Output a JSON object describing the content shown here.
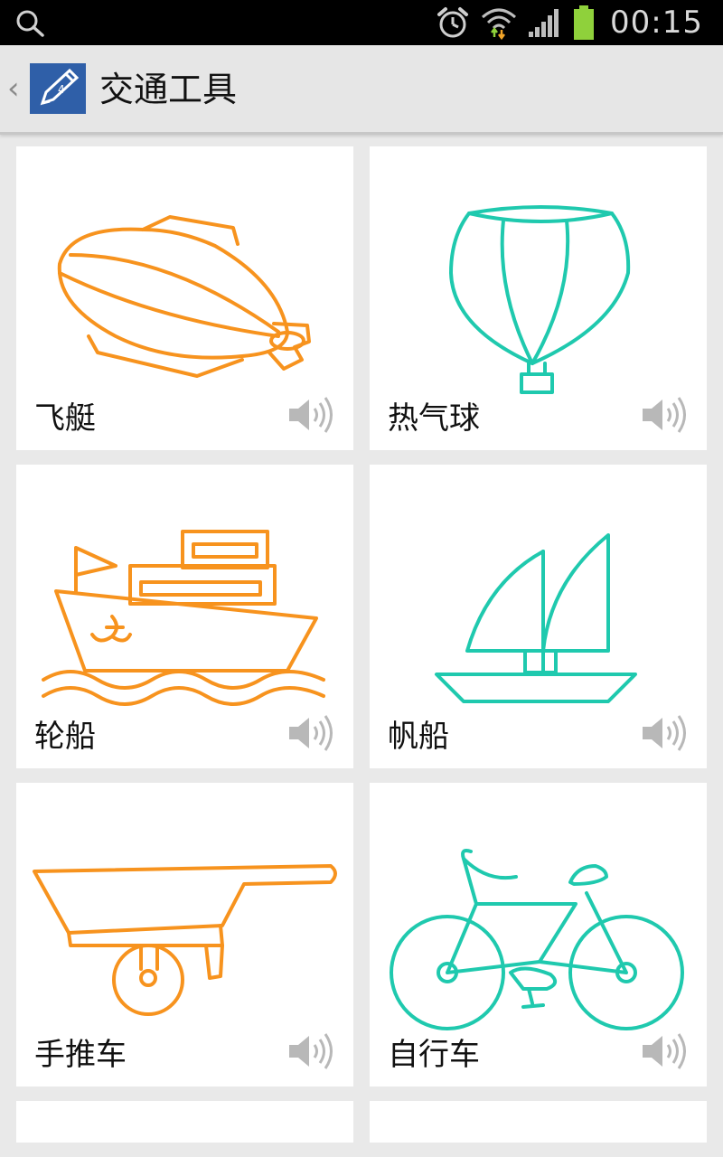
{
  "status_bar": {
    "time": "00:15"
  },
  "action_bar": {
    "title": "交通工具"
  },
  "items": [
    {
      "label": "飞艇"
    },
    {
      "label": "热气球"
    },
    {
      "label": "轮船"
    },
    {
      "label": "帆船"
    },
    {
      "label": "手推车"
    },
    {
      "label": "自行车"
    }
  ],
  "colors": {
    "orange": "#f7931e",
    "teal": "#1fc9ae",
    "app_icon_bg": "#2f5fa8"
  }
}
